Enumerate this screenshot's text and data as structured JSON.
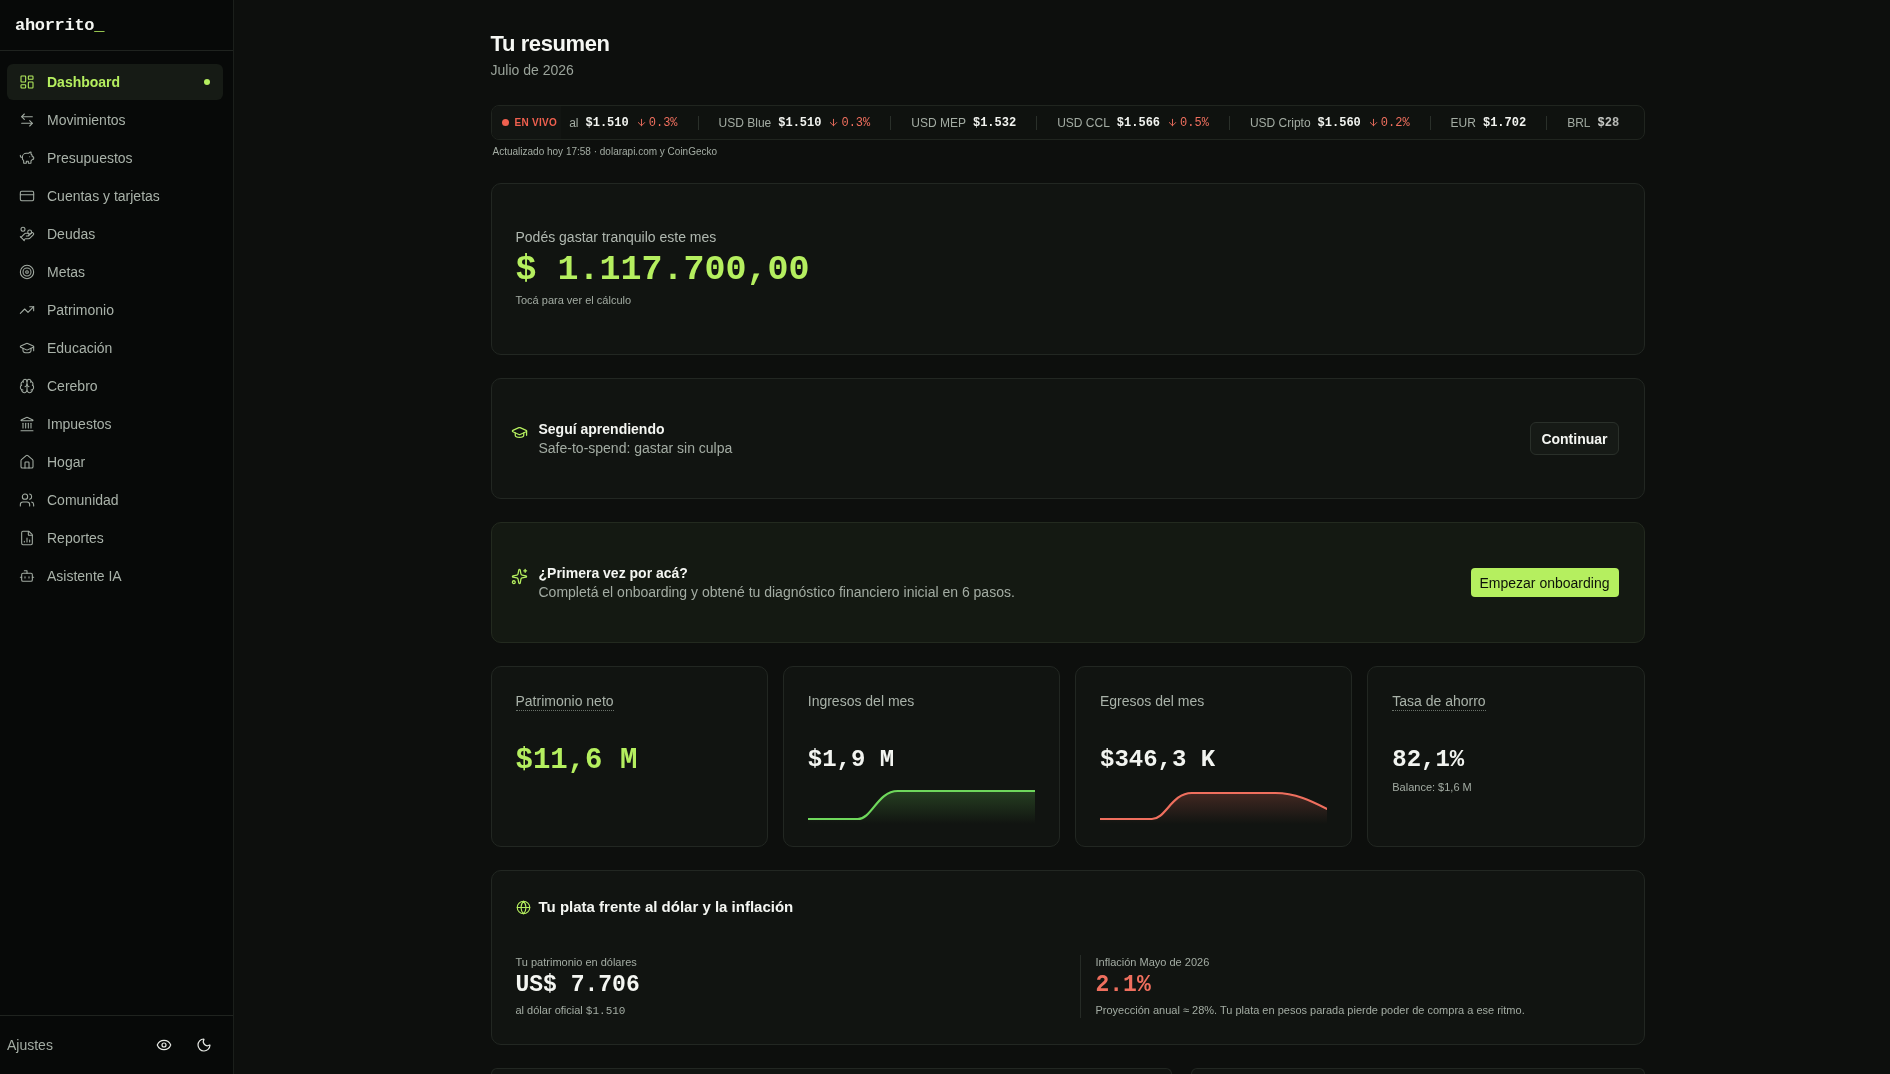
{
  "sidebar": {
    "logo": {
      "text": "ahorrito",
      "cursor": "_"
    },
    "items": [
      {
        "label": "Dashboard",
        "selected": true
      },
      {
        "label": "Movimientos",
        "selected": false
      },
      {
        "label": "Presupuestos",
        "selected": false
      },
      {
        "label": "Cuentas y tarjetas",
        "selected": false
      },
      {
        "label": "Deudas",
        "selected": false
      },
      {
        "label": "Metas",
        "selected": false
      },
      {
        "label": "Patrimonio",
        "selected": false
      },
      {
        "label": "Educación",
        "selected": false
      },
      {
        "label": "Cerebro",
        "selected": false
      },
      {
        "label": "Impuestos",
        "selected": false
      },
      {
        "label": "Hogar",
        "selected": false
      },
      {
        "label": "Comunidad",
        "selected": false
      },
      {
        "label": "Reportes",
        "selected": false
      },
      {
        "label": "Asistente IA",
        "selected": false
      }
    ],
    "footer": {
      "settings": "Ajustes"
    }
  },
  "header": {
    "title": "Tu resumen",
    "subtitle": "Julio de 2026"
  },
  "ticker": {
    "live_badge": "EN VIVO",
    "items": [
      {
        "label": "al",
        "value": "$1.510",
        "change": "0.3%",
        "down": true
      },
      {
        "label": "USD Blue",
        "value": "$1.510",
        "change": "0.3%",
        "down": true
      },
      {
        "label": "USD MEP",
        "value": "$1.532"
      },
      {
        "label": "USD CCL",
        "value": "$1.566",
        "change": "0.5%",
        "down": true
      },
      {
        "label": "USD Cripto",
        "value": "$1.560",
        "change": "0.2%",
        "down": true
      },
      {
        "label": "EUR",
        "value": "$1.702"
      },
      {
        "label": "BRL",
        "value": "$28"
      }
    ],
    "updated": "Actualizado hoy 17:58 · dolarapi.com y CoinGecko"
  },
  "safe_to_spend": {
    "label": "Podés gastar tranquilo este mes",
    "amount": "$ 1.117.700,00",
    "hint": "Tocá para ver el cálculo"
  },
  "learning": {
    "title": "Seguí aprendiendo",
    "subtitle": "Safe-to-spend: gastar sin culpa",
    "button": "Continuar"
  },
  "onboarding": {
    "title": "¿Primera vez por acá?",
    "subtitle": "Completá el onboarding y obtené tu diagnóstico financiero inicial en 6 pasos.",
    "button": "Empezar onboarding"
  },
  "stats": [
    {
      "kind": "value",
      "label": "Patrimonio neto",
      "value": "$11,6 M",
      "underlined": true,
      "accent": true
    },
    {
      "kind": "rise",
      "label": "Ingresos del mes",
      "value": "$1,9 M",
      "underlined": false,
      "accent": false,
      "color": "#6fd85c"
    },
    {
      "kind": "peak",
      "label": "Egresos del mes",
      "value": "$346,3 K",
      "underlined": false,
      "accent": false,
      "color": "#ef6f5e"
    },
    {
      "kind": "note",
      "label": "Tasa de ahorro",
      "value": "82,1%",
      "underlined": true,
      "accent": false,
      "note": "Balance: $1,6 M"
    }
  ],
  "currency_card": {
    "title": "Tu plata frente al dólar y la inflación",
    "usd": {
      "label": "Tu patrimonio en dólares",
      "value": "US$ 7.706",
      "note": "al dólar oficial",
      "rate": "$1.510"
    },
    "inflation": {
      "label": "Inflación Mayo de 2026",
      "value": "2.1%",
      "note": "Proyección anual ≈ 28%. Tu plata en pesos parada pierde poder de compra a ese ritmo."
    }
  }
}
